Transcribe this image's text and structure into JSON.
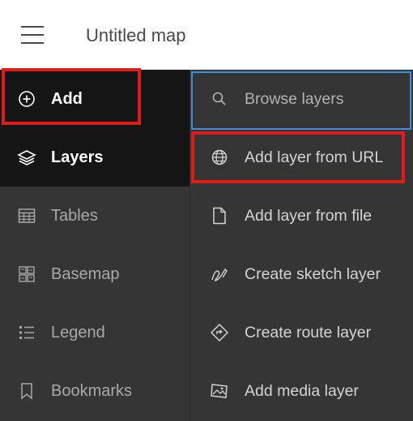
{
  "header": {
    "title": "Untitled map"
  },
  "nav": {
    "items": [
      {
        "label": "Add",
        "icon": "plus-circle-icon"
      },
      {
        "label": "Layers",
        "icon": "layers-icon"
      },
      {
        "label": "Tables",
        "icon": "table-icon"
      },
      {
        "label": "Basemap",
        "icon": "basemap-icon"
      },
      {
        "label": "Legend",
        "icon": "legend-icon"
      },
      {
        "label": "Bookmarks",
        "icon": "bookmark-icon"
      }
    ]
  },
  "add_menu": {
    "items": [
      {
        "label": "Browse layers",
        "icon": "search-icon"
      },
      {
        "label": "Add layer from URL",
        "icon": "globe-icon"
      },
      {
        "label": "Add layer from file",
        "icon": "file-icon"
      },
      {
        "label": "Create sketch layer",
        "icon": "sketch-icon"
      },
      {
        "label": "Create route layer",
        "icon": "route-icon"
      },
      {
        "label": "Add media layer",
        "icon": "media-icon"
      }
    ]
  },
  "colors": {
    "panel": "#353535",
    "panel_active": "#151515",
    "highlight": "#e01b1b",
    "focus": "#3b8fd9"
  }
}
